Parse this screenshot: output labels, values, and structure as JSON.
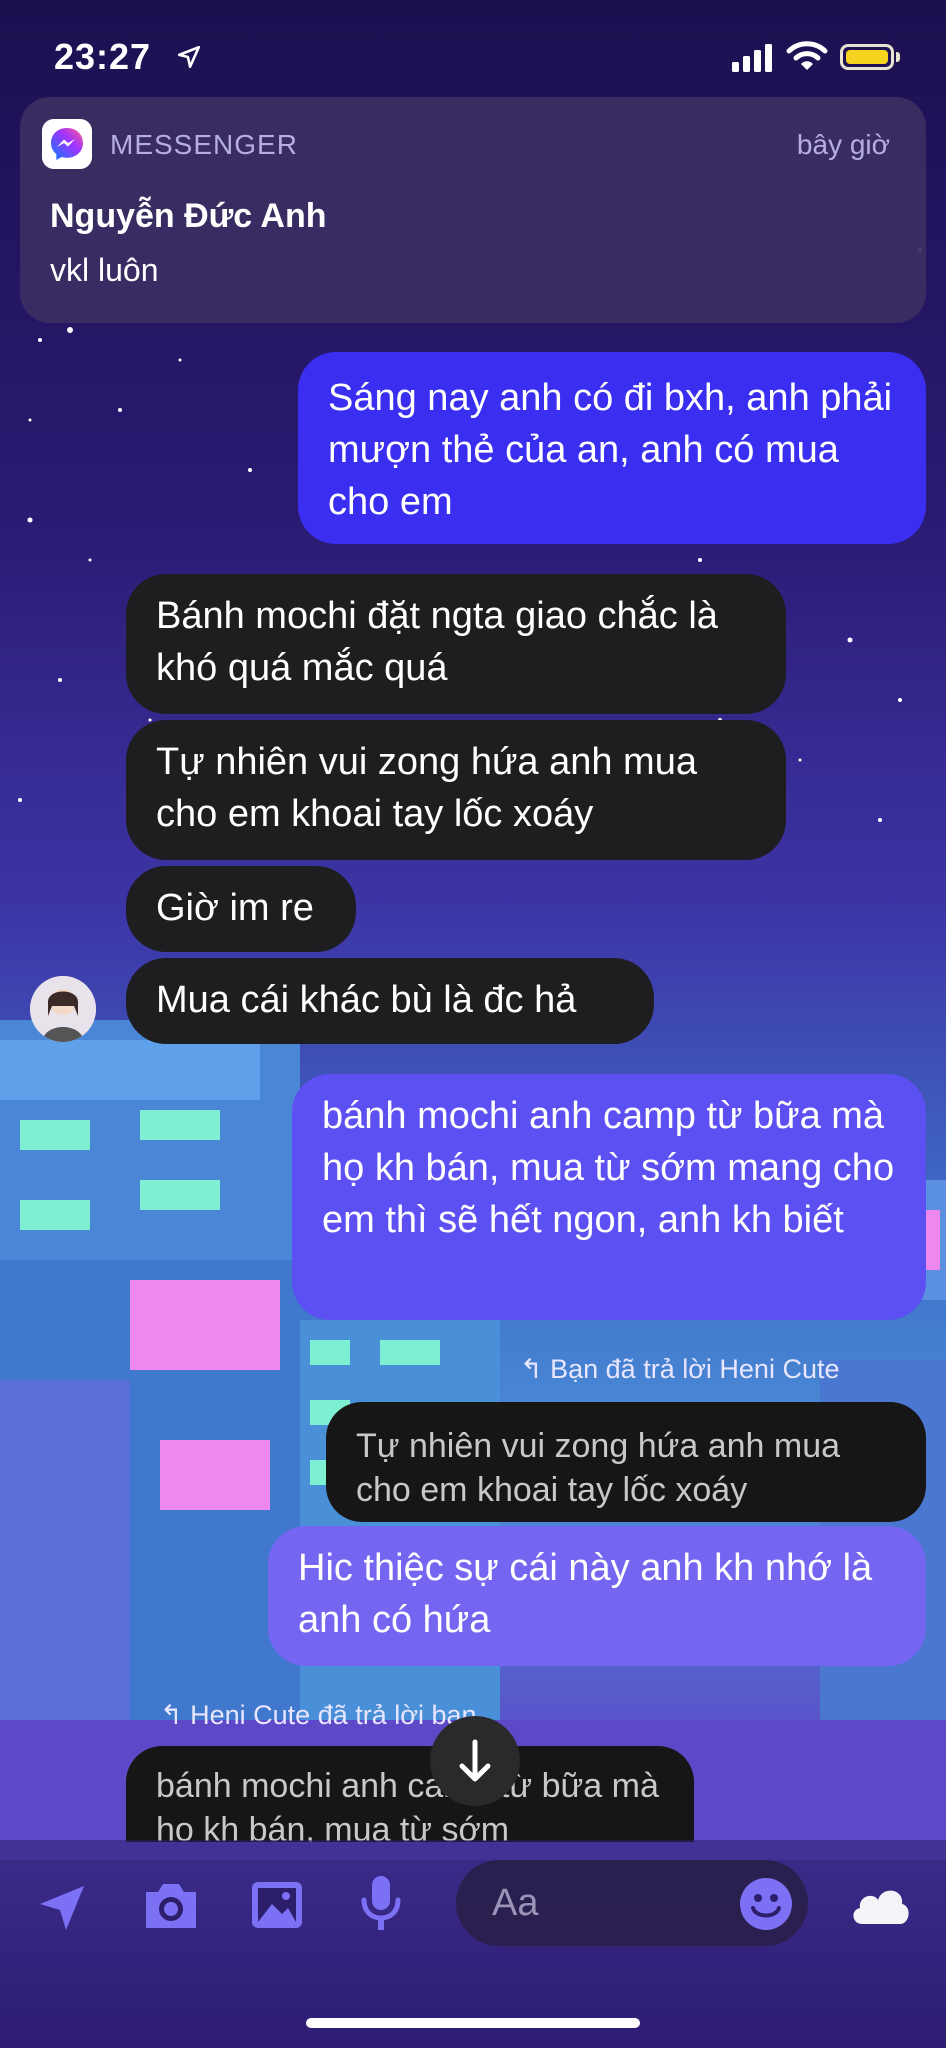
{
  "status_bar": {
    "time": "23:27"
  },
  "notification": {
    "app": "MESSENGER",
    "time": "bây giờ",
    "title": "Nguyễn Đức Anh",
    "body": "vkl luôn"
  },
  "messages": [
    {
      "from": "me",
      "text": "Sáng nay anh có đi bxh, anh phải mượn thẻ của an, anh có mua cho em"
    },
    {
      "from": "them",
      "text": "Bánh mochi đặt ngta giao chắc là khó quá mắc quá"
    },
    {
      "from": "them",
      "text": "Tự nhiên vui zong hứa anh mua cho em khoai tay lốc xoáy"
    },
    {
      "from": "them",
      "text": "Giờ im re"
    },
    {
      "from": "them",
      "text": "Mua cái khác bù là đc hả"
    },
    {
      "from": "me",
      "text": "bánh mochi anh camp từ bữa mà họ kh bán, mua từ sớm mang cho em thì sẽ hết ngon, anh kh biết"
    }
  ],
  "reply_1": {
    "label": "Bạn đã trả lời Heni Cute",
    "quoted": "Tự nhiên vui zong hứa anh mua cho em khoai tay lốc xoáy",
    "text": "Hic thiệc sự cái này anh kh nhớ là anh có hứa"
  },
  "reply_2": {
    "label": "Heni Cute đã trả lời bạn",
    "quoted": "bánh mochi anh camp từ bữa mà họ kh bán, mua từ sớm"
  },
  "composer": {
    "placeholder": "Aa",
    "icons": [
      "send-location-icon",
      "camera-icon",
      "photo-icon",
      "microphone-icon",
      "emoji-icon",
      "cloud-icon"
    ]
  },
  "colors": {
    "outgoing": "#3a2ff0",
    "incoming": "#1e1e20",
    "battery": "#f5d31e"
  }
}
